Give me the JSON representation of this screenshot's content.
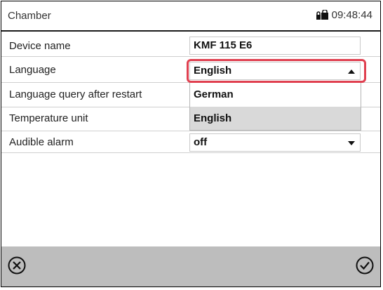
{
  "header": {
    "title": "Chamber",
    "time": "09:48:44"
  },
  "rows": [
    {
      "label": "Device name",
      "value": "KMF 115 E6"
    },
    {
      "label": "Language",
      "value": "English"
    },
    {
      "label": "Language query after restart"
    },
    {
      "label": "Temperature unit"
    },
    {
      "label": "Audible alarm",
      "value": "off"
    }
  ],
  "dropdown": {
    "options": [
      "German",
      "English"
    ],
    "selected": "English"
  },
  "colors": {
    "highlight": "#e04050",
    "footer": "#bdbdbd",
    "selected_option": "#d9d9d9"
  },
  "icons": {
    "header_status": "lock-icon",
    "footer_left": "cancel-icon",
    "footer_right": "confirm-icon"
  }
}
